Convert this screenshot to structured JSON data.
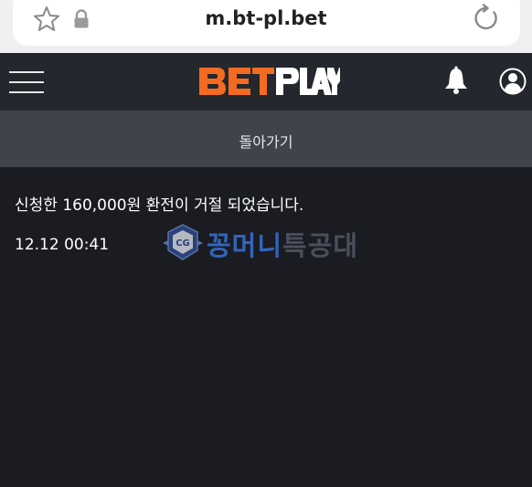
{
  "browser": {
    "url": "m.bt-pl.bet",
    "icons": [
      "star-icon",
      "lock-icon",
      "refresh-icon"
    ]
  },
  "header": {
    "logo_text": "BETPLAY",
    "icons": [
      "menu-icon",
      "bell-icon",
      "user-icon"
    ],
    "logo_colors": {
      "bet": "#f26b21",
      "play": "#ffffff"
    }
  },
  "back_bar": {
    "label": "돌아가기"
  },
  "notification": {
    "message": "신청한 160,000원 환전이 거절 되었습니다.",
    "time": "12.12 00:41"
  },
  "watermark": {
    "text_a": "꽁머니",
    "text_b": "특공대"
  },
  "colors": {
    "background": "#1a1c22",
    "header": "#24272d",
    "back_bar": "#3f444c",
    "accent": "#f26b21"
  }
}
